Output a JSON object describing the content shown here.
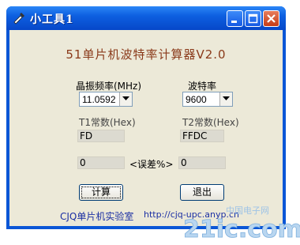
{
  "window": {
    "title": "小工具1"
  },
  "main": {
    "heading": "51单片机波特率计算器V2.0",
    "crystal_label": "晶振频率(MHz)",
    "crystal_value": "11.0592",
    "baud_label": "波特率",
    "baud_value": "9600",
    "t1_label": "T1常数(Hex)",
    "t1_value": "FD",
    "t2_label": "T2常数(Hex)",
    "t2_value": "FFDC",
    "left_error": "0",
    "error_label": "<误差%>",
    "right_error": "0",
    "calc_button": "计算",
    "exit_button": "退出",
    "footer_lab": "CJQ单片机实验室",
    "footer_url": "http://cjq-upc.anyp.cn"
  },
  "watermark": {
    "text": "21ic.com",
    "subtitle": "中国电子网"
  },
  "colors": {
    "titlebar": "#0a56d6",
    "client_bg": "#ece9d8",
    "heading": "#8a3a1a",
    "footer_link": "#1b2fa3",
    "close_button": "#c63c16"
  },
  "icons": [
    "app-icon",
    "minimize-icon",
    "maximize-icon",
    "close-icon",
    "dropdown-arrow-icon"
  ]
}
